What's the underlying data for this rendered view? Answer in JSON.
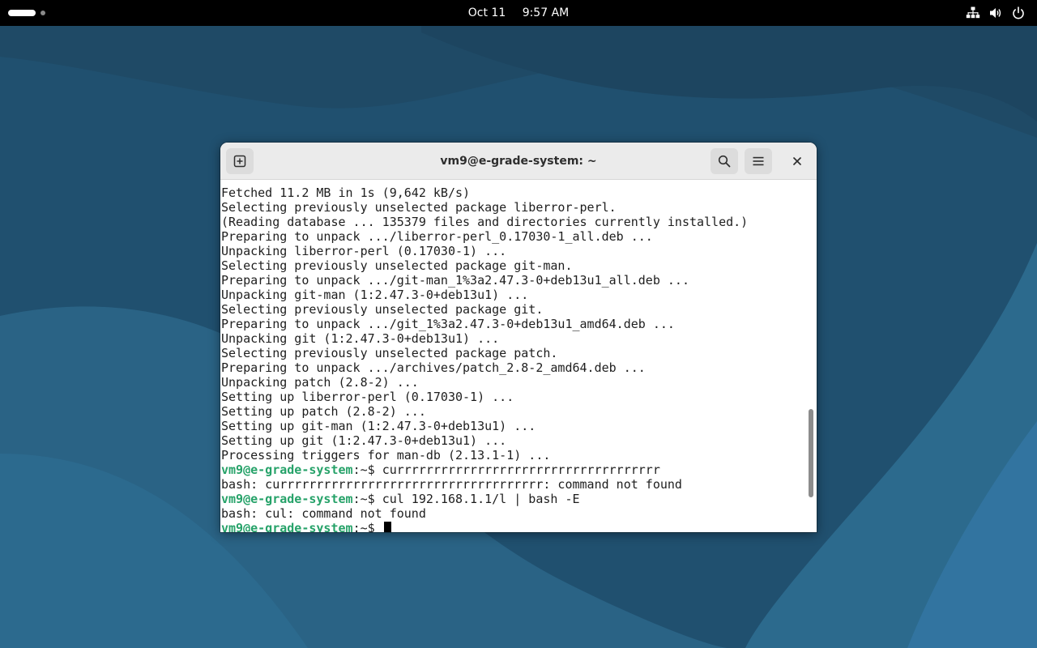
{
  "topbar": {
    "date": "Oct 11",
    "time": "9:57 AM",
    "tray_icons": [
      "network-icon",
      "volume-icon",
      "power-icon"
    ]
  },
  "window": {
    "title": "vm9@e-grade-system: ~",
    "new_tab_icon": "new-tab-icon",
    "search_icon": "search-icon",
    "menu_icon": "hamburger-menu-icon",
    "close_icon": "close-icon",
    "scroll_position": 0.88,
    "scroll_visible_fraction": 0.25
  },
  "terminal": {
    "prompt_user": "vm9@e-grade-system",
    "prompt_suffix": ":~$ ",
    "lines": [
      {
        "kind": "output",
        "text": "Fetched 11.2 MB in 1s (9,642 kB/s)"
      },
      {
        "kind": "output",
        "text": "Selecting previously unselected package liberror-perl."
      },
      {
        "kind": "output",
        "text": "(Reading database ... 135379 files and directories currently installed.)"
      },
      {
        "kind": "output",
        "text": "Preparing to unpack .../liberror-perl_0.17030-1_all.deb ..."
      },
      {
        "kind": "output",
        "text": "Unpacking liberror-perl (0.17030-1) ..."
      },
      {
        "kind": "output",
        "text": "Selecting previously unselected package git-man."
      },
      {
        "kind": "output",
        "text": "Preparing to unpack .../git-man_1%3a2.47.3-0+deb13u1_all.deb ..."
      },
      {
        "kind": "output",
        "text": "Unpacking git-man (1:2.47.3-0+deb13u1) ..."
      },
      {
        "kind": "output",
        "text": "Selecting previously unselected package git."
      },
      {
        "kind": "output",
        "text": "Preparing to unpack .../git_1%3a2.47.3-0+deb13u1_amd64.deb ..."
      },
      {
        "kind": "output",
        "text": "Unpacking git (1:2.47.3-0+deb13u1) ..."
      },
      {
        "kind": "output",
        "text": "Selecting previously unselected package patch."
      },
      {
        "kind": "output",
        "text": "Preparing to unpack .../archives/patch_2.8-2_amd64.deb ..."
      },
      {
        "kind": "output",
        "text": "Unpacking patch (2.8-2) ..."
      },
      {
        "kind": "output",
        "text": "Setting up liberror-perl (0.17030-1) ..."
      },
      {
        "kind": "output",
        "text": "Setting up patch (2.8-2) ..."
      },
      {
        "kind": "output",
        "text": "Setting up git-man (1:2.47.3-0+deb13u1) ..."
      },
      {
        "kind": "output",
        "text": "Setting up git (1:2.47.3-0+deb13u1) ..."
      },
      {
        "kind": "output",
        "text": "Processing triggers for man-db (2.13.1-1) ..."
      },
      {
        "kind": "prompt",
        "command": "currrrrrrrrrrrrrrrrrrrrrrrrrrrrrrrrrrr"
      },
      {
        "kind": "output",
        "text": "bash: currrrrrrrrrrrrrrrrrrrrrrrrrrrrrrrrrrr: command not found"
      },
      {
        "kind": "prompt",
        "command": "cul 192.168.1.1/l | bash -E"
      },
      {
        "kind": "output",
        "text": "bash: cul: command not found"
      },
      {
        "kind": "prompt",
        "command": "",
        "cursor": true
      }
    ]
  },
  "colors": {
    "prompt_user": "#26a269",
    "text": "#1e1e1e",
    "topbar": "#000000",
    "wallpaper_base": "#20506f",
    "headerbar": "#ebebeb"
  }
}
